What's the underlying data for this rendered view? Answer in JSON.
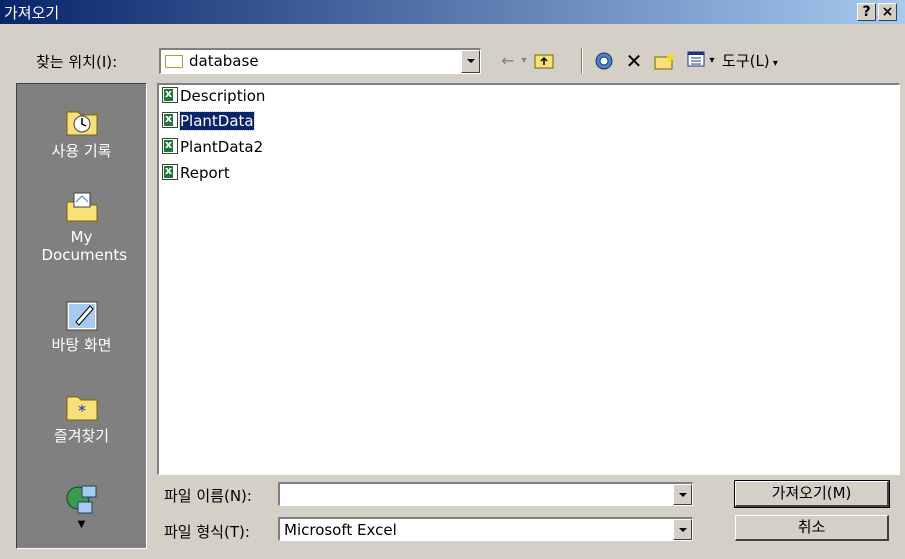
{
  "window": {
    "title": "가져오기",
    "help_label": "?",
    "close_label": "×"
  },
  "toolbar": {
    "look_in_label": "찾는 위치(I):",
    "look_in_value": "database",
    "tools_label": "도구(L)"
  },
  "places": [
    {
      "label": "사용 기록",
      "icon": "history-icon"
    },
    {
      "label": "My Documents",
      "icon": "my-documents-icon"
    },
    {
      "label": "바탕 화면",
      "icon": "desktop-icon"
    },
    {
      "label": "즐겨찾기",
      "icon": "favorites-icon"
    },
    {
      "label": "",
      "icon": "network-places-icon"
    }
  ],
  "files": [
    {
      "name": "Description",
      "selected": false
    },
    {
      "name": "PlantData",
      "selected": true
    },
    {
      "name": "PlantData2",
      "selected": false
    },
    {
      "name": "Report",
      "selected": false
    }
  ],
  "form": {
    "filename_label": "파일 이름(N):",
    "filename_value": "",
    "filetype_label": "파일 형식(T):",
    "filetype_value": "Microsoft Excel"
  },
  "buttons": {
    "import_label": "가져오기(M)",
    "cancel_label": "취소"
  },
  "colors": {
    "titlebar_start": "#0a246a",
    "titlebar_end": "#a6caf0",
    "dialog_bg": "#d4d0c8",
    "places_bg": "#808080",
    "selection": "#0a246a"
  }
}
